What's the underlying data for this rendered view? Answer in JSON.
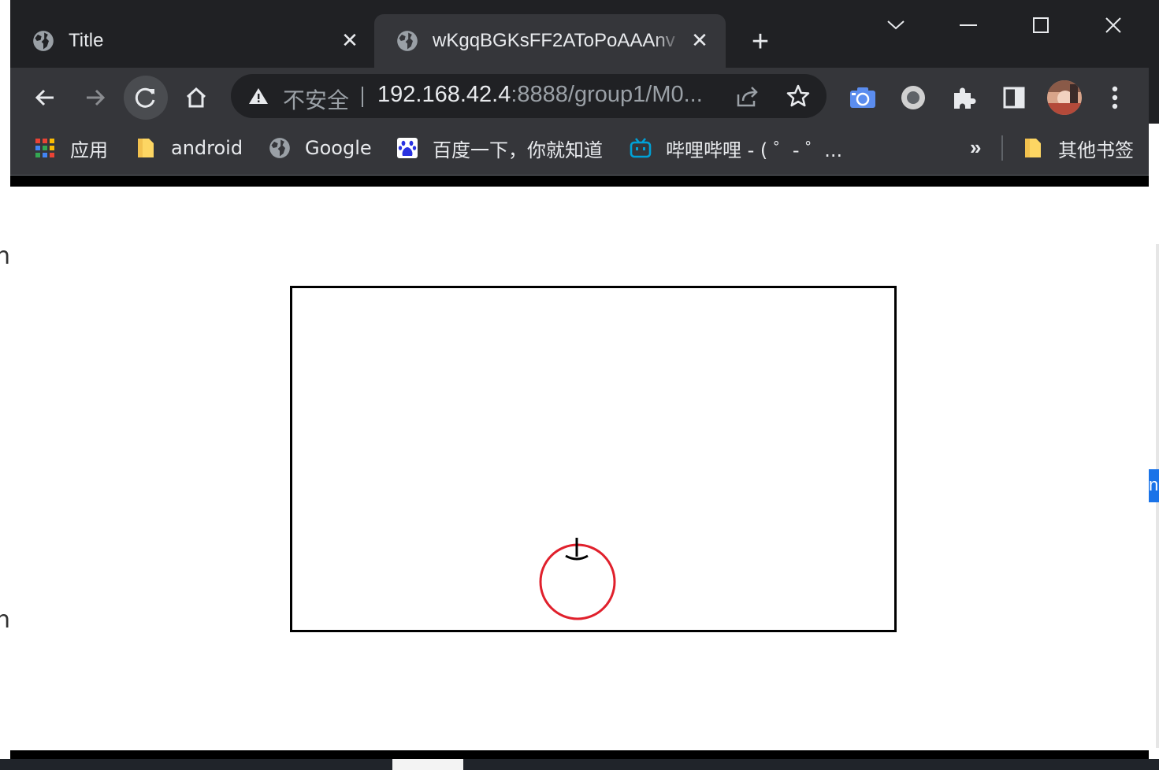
{
  "tabs": [
    {
      "title": "Title",
      "close": "✕"
    },
    {
      "title": "wKgqBGKsFF2AToPoAAAnv",
      "close": "✕"
    }
  ],
  "new_tab": "+",
  "omnibox": {
    "security_label": "不安全",
    "url_host": "192.168.42.4",
    "url_path": ":8888/group1/M0..."
  },
  "bookmarks": {
    "apps": "应用",
    "items": [
      {
        "label": "android",
        "icon": "folder-icon"
      },
      {
        "label": "Google",
        "icon": "globe-icon"
      },
      {
        "label": "百度一下，你就知道",
        "icon": "baidu-icon"
      },
      {
        "label": "哔哩哔哩 - ( ゜- ゜...",
        "icon": "bilibili-icon"
      }
    ],
    "more": "»",
    "other": "其他书签"
  },
  "underlying_window": {
    "left_glyph": "n",
    "right_glyph": "n"
  },
  "colors": {
    "chrome_dark": "#202124",
    "toolbar": "#35363a",
    "ball": "#e0202c",
    "canvas_border": "#000000"
  }
}
